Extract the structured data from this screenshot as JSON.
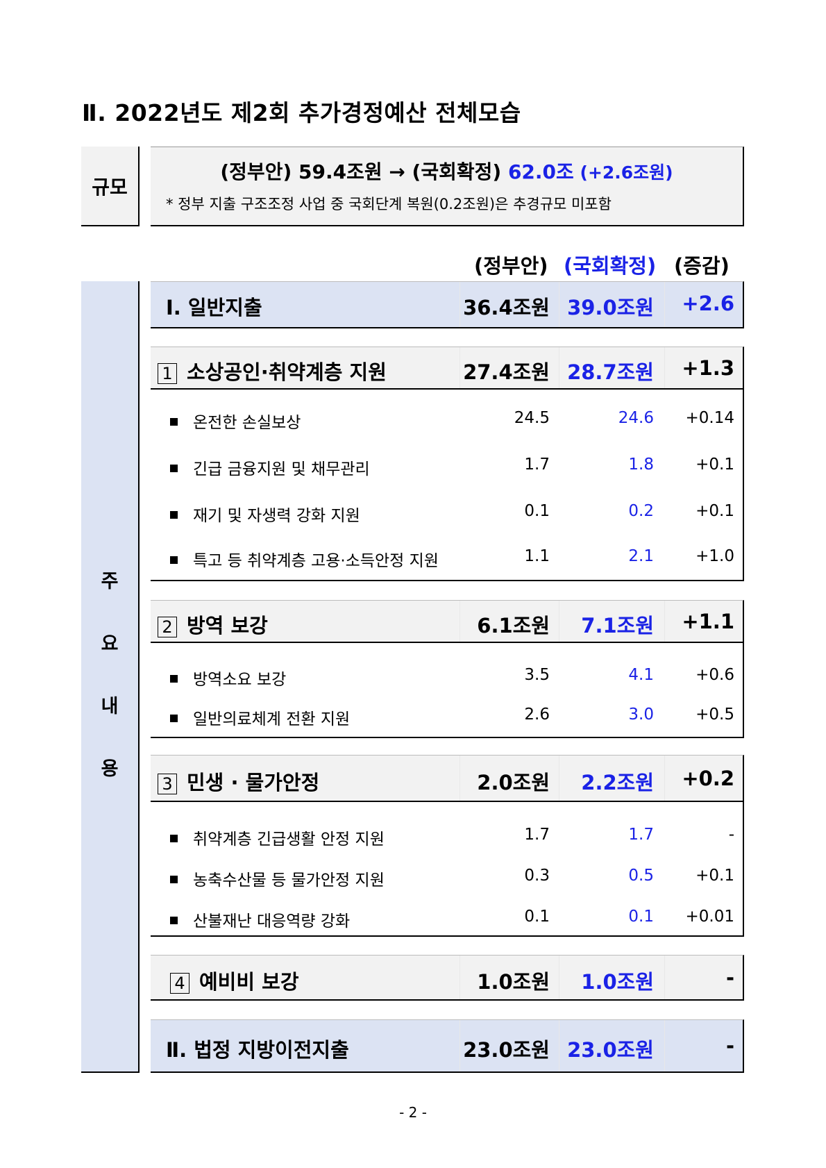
{
  "title": "Ⅱ. 2022년도 제2회 추가경정예산 전체모습",
  "scale": {
    "label": "규모",
    "main_prefix": "(정부안) 59.4조원 → (국회확정) ",
    "main_value": "62.0조",
    "main_change": " (+2.6조원)",
    "note": "* 정부 지출 구조조정 사업 중 국회단계 복원(0.2조원)은 추경규모 미포함"
  },
  "columns": {
    "gov": "(정부안)",
    "assembly": "(국회확정)",
    "change": "(증감)"
  },
  "sidebar": {
    "chars": [
      "주",
      "요",
      "내",
      "용"
    ]
  },
  "general": {
    "label": "Ⅰ. 일반지출",
    "gov": "36.4조원",
    "assembly": "39.0조원",
    "change": "+2.6"
  },
  "sections": [
    {
      "num": "1",
      "label": "소상공인·취약계층 지원",
      "gov": "27.4조원",
      "assembly": "28.7조원",
      "change": "+1.3",
      "items": [
        {
          "label": "온전한 손실보상",
          "gov": "24.5",
          "assembly": "24.6",
          "change": "+0.14"
        },
        {
          "label": "긴급 금융지원 및 채무관리",
          "gov": "1.7",
          "assembly": "1.8",
          "change": "+0.1"
        },
        {
          "label": "재기 및 자생력 강화 지원",
          "gov": "0.1",
          "assembly": "0.2",
          "change": "+0.1"
        },
        {
          "label": "특고 등 취약계층 고용·소득안정 지원",
          "gov": "1.1",
          "assembly": "2.1",
          "change": "+1.0"
        }
      ]
    },
    {
      "num": "2",
      "label": "방역 보강",
      "gov": "6.1조원",
      "assembly": "7.1조원",
      "change": "+1.1",
      "items": [
        {
          "label": "방역소요 보강",
          "gov": "3.5",
          "assembly": "4.1",
          "change": "+0.6"
        },
        {
          "label": "일반의료체계 전환 지원",
          "gov": "2.6",
          "assembly": "3.0",
          "change": "+0.5"
        }
      ]
    },
    {
      "num": "3",
      "label": "민생 · 물가안정",
      "gov": "2.0조원",
      "assembly": "2.2조원",
      "change": "+0.2",
      "items": [
        {
          "label": "취약계층 긴급생활 안정 지원",
          "gov": "1.7",
          "assembly": "1.7",
          "change": "-"
        },
        {
          "label": "농축수산물 등 물가안정 지원",
          "gov": "0.3",
          "assembly": "0.5",
          "change": "+0.1"
        },
        {
          "label": "산불재난 대응역량 강화",
          "gov": "0.1",
          "assembly": "0.1",
          "change": "+0.01"
        }
      ]
    },
    {
      "num": "4",
      "label": "예비비 보강",
      "gov": "1.0조원",
      "assembly": "1.0조원",
      "change": "-",
      "items": []
    }
  ],
  "transfer": {
    "label": "Ⅱ. 법정 지방이전지출",
    "gov": "23.0조원",
    "assembly": "23.0조원",
    "change": "-"
  },
  "footer": "- 2 -"
}
